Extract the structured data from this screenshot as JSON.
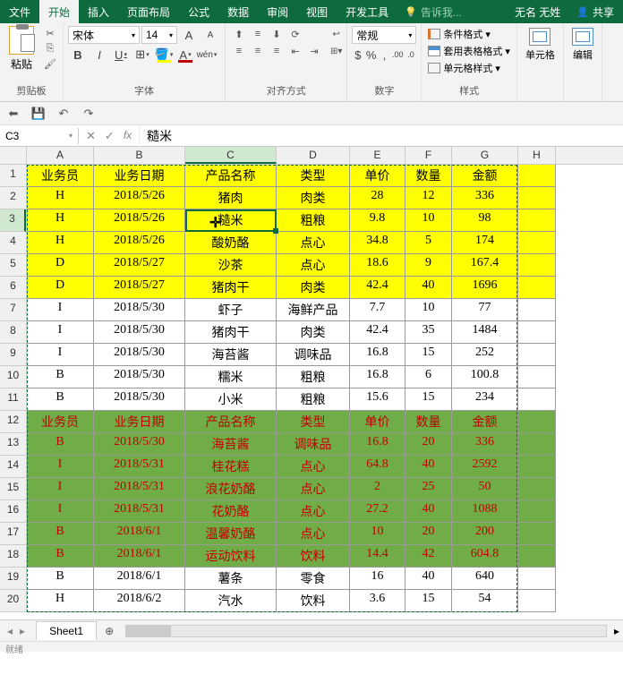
{
  "app": {
    "user": "无名 无姓",
    "share": "共享",
    "tell_me": "告诉我..."
  },
  "tabs": {
    "file": "文件",
    "home": "开始",
    "insert": "插入",
    "layout": "页面布局",
    "formula": "公式",
    "data": "数据",
    "review": "审阅",
    "view": "视图",
    "dev": "开发工具"
  },
  "ribbon": {
    "clipboard": {
      "paste": "粘贴",
      "label": "剪贴板"
    },
    "font": {
      "name": "宋体",
      "size": "14",
      "label": "字体"
    },
    "align": {
      "label": "对齐方式"
    },
    "number": {
      "format": "常规",
      "label": "数字"
    },
    "styles": {
      "cond": "条件格式",
      "tbl": "套用表格格式",
      "cell": "单元格样式",
      "label": "样式"
    },
    "cells": {
      "label": "单元格"
    },
    "editing": {
      "label": "编辑"
    }
  },
  "namebox": "C3",
  "formula": "糙米",
  "columns": [
    "A",
    "B",
    "C",
    "D",
    "E",
    "F",
    "G",
    "H"
  ],
  "rows": [
    {
      "n": "1",
      "s": "yellow",
      "c": [
        "业务员",
        "业务日期",
        "产品名称",
        "类型",
        "单价",
        "数量",
        "金额",
        ""
      ]
    },
    {
      "n": "2",
      "s": "yellow",
      "c": [
        "H",
        "2018/5/26",
        "猪肉",
        "肉类",
        "28",
        "12",
        "336",
        ""
      ]
    },
    {
      "n": "3",
      "s": "yellow",
      "c": [
        "H",
        "2018/5/26",
        "糙米",
        "粗粮",
        "9.8",
        "10",
        "98",
        ""
      ]
    },
    {
      "n": "4",
      "s": "yellow",
      "c": [
        "H",
        "2018/5/26",
        "酸奶酪",
        "点心",
        "34.8",
        "5",
        "174",
        ""
      ]
    },
    {
      "n": "5",
      "s": "yellow",
      "c": [
        "D",
        "2018/5/27",
        "沙茶",
        "点心",
        "18.6",
        "9",
        "167.4",
        ""
      ]
    },
    {
      "n": "6",
      "s": "yellow",
      "c": [
        "D",
        "2018/5/27",
        "猪肉干",
        "肉类",
        "42.4",
        "40",
        "1696",
        ""
      ]
    },
    {
      "n": "7",
      "s": "plain",
      "c": [
        "I",
        "2018/5/30",
        "虾子",
        "海鲜产品",
        "7.7",
        "10",
        "77",
        ""
      ]
    },
    {
      "n": "8",
      "s": "plain",
      "c": [
        "I",
        "2018/5/30",
        "猪肉干",
        "肉类",
        "42.4",
        "35",
        "1484",
        ""
      ]
    },
    {
      "n": "9",
      "s": "plain",
      "c": [
        "I",
        "2018/5/30",
        "海苔酱",
        "调味品",
        "16.8",
        "15",
        "252",
        ""
      ]
    },
    {
      "n": "10",
      "s": "plain",
      "c": [
        "B",
        "2018/5/30",
        "糯米",
        "粗粮",
        "16.8",
        "6",
        "100.8",
        ""
      ]
    },
    {
      "n": "11",
      "s": "plain",
      "c": [
        "B",
        "2018/5/30",
        "小米",
        "粗粮",
        "15.6",
        "15",
        "234",
        ""
      ]
    },
    {
      "n": "12",
      "s": "green",
      "c": [
        "业务员",
        "业务日期",
        "产品名称",
        "类型",
        "单价",
        "数量",
        "金额",
        ""
      ]
    },
    {
      "n": "13",
      "s": "green",
      "c": [
        "B",
        "2018/5/30",
        "海苔酱",
        "调味品",
        "16.8",
        "20",
        "336",
        ""
      ]
    },
    {
      "n": "14",
      "s": "green",
      "c": [
        "I",
        "2018/5/31",
        "桂花糕",
        "点心",
        "64.8",
        "40",
        "2592",
        ""
      ]
    },
    {
      "n": "15",
      "s": "green",
      "c": [
        "I",
        "2018/5/31",
        "浪花奶酪",
        "点心",
        "2",
        "25",
        "50",
        ""
      ]
    },
    {
      "n": "16",
      "s": "green",
      "c": [
        "I",
        "2018/5/31",
        "花奶酪",
        "点心",
        "27.2",
        "40",
        "1088",
        ""
      ]
    },
    {
      "n": "17",
      "s": "green",
      "c": [
        "B",
        "2018/6/1",
        "温馨奶酪",
        "点心",
        "10",
        "20",
        "200",
        ""
      ]
    },
    {
      "n": "18",
      "s": "green",
      "c": [
        "B",
        "2018/6/1",
        "运动饮料",
        "饮料",
        "14.4",
        "42",
        "604.8",
        ""
      ]
    },
    {
      "n": "19",
      "s": "plain",
      "c": [
        "B",
        "2018/6/1",
        "薯条",
        "零食",
        "16",
        "40",
        "640",
        ""
      ]
    },
    {
      "n": "20",
      "s": "plain",
      "c": [
        "H",
        "2018/6/2",
        "汽水",
        "饮料",
        "3.6",
        "15",
        "54",
        ""
      ]
    }
  ],
  "sheet": {
    "name": "Sheet1",
    "add": "⊕"
  },
  "status": "就绪"
}
